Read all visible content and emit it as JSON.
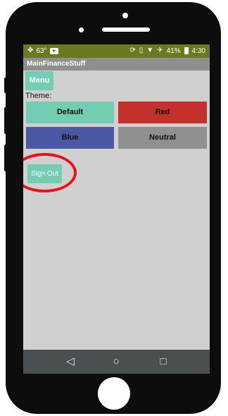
{
  "status_bar": {
    "fan_icon": "fan-icon",
    "temperature": "63°",
    "video_icon": "youtube-icon",
    "sync_icon": "sync-icon",
    "vibrate_icon": "vibrate-icon",
    "wifi_icon": "wifi-icon",
    "airplane_icon": "airplane-icon",
    "battery_percent": "41%",
    "battery_icon": "battery-icon",
    "time": "4:30",
    "background_color": "#6b7a22"
  },
  "app": {
    "title": "MainFinanceStuff",
    "menu_label": "Menu",
    "theme_label": "Theme:",
    "themes": [
      {
        "label": "Default",
        "color": "#74cdb2"
      },
      {
        "label": "Red",
        "color": "#c4302b"
      },
      {
        "label": "Blue",
        "color": "#4b58a3"
      },
      {
        "label": "Neutral",
        "color": "#909090"
      }
    ],
    "sign_out_label": "Sign Out",
    "accent_color": "#74cdb2"
  },
  "nav_bar": {
    "back_glyph": "◁",
    "home_glyph": "○",
    "recent_glyph": "□"
  },
  "annotation": {
    "highlight_color": "#e8141c"
  }
}
